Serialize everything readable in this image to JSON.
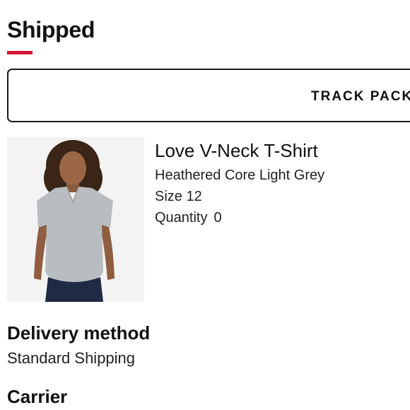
{
  "order": {
    "status_title": "Shipped",
    "accent_color": "#d31334",
    "track_button_label": "TRACK PACK"
  },
  "product": {
    "image_icon": "product-photo-grey-v-neck-tshirt",
    "name": "Love V-Neck T-Shirt",
    "color": "Heathered Core Light Grey",
    "size": "Size 12",
    "quantity_label": "Quantity",
    "quantity_value": "0"
  },
  "delivery": {
    "heading": "Delivery method",
    "value": "Standard Shipping"
  },
  "carrier": {
    "heading": "Carrier"
  }
}
